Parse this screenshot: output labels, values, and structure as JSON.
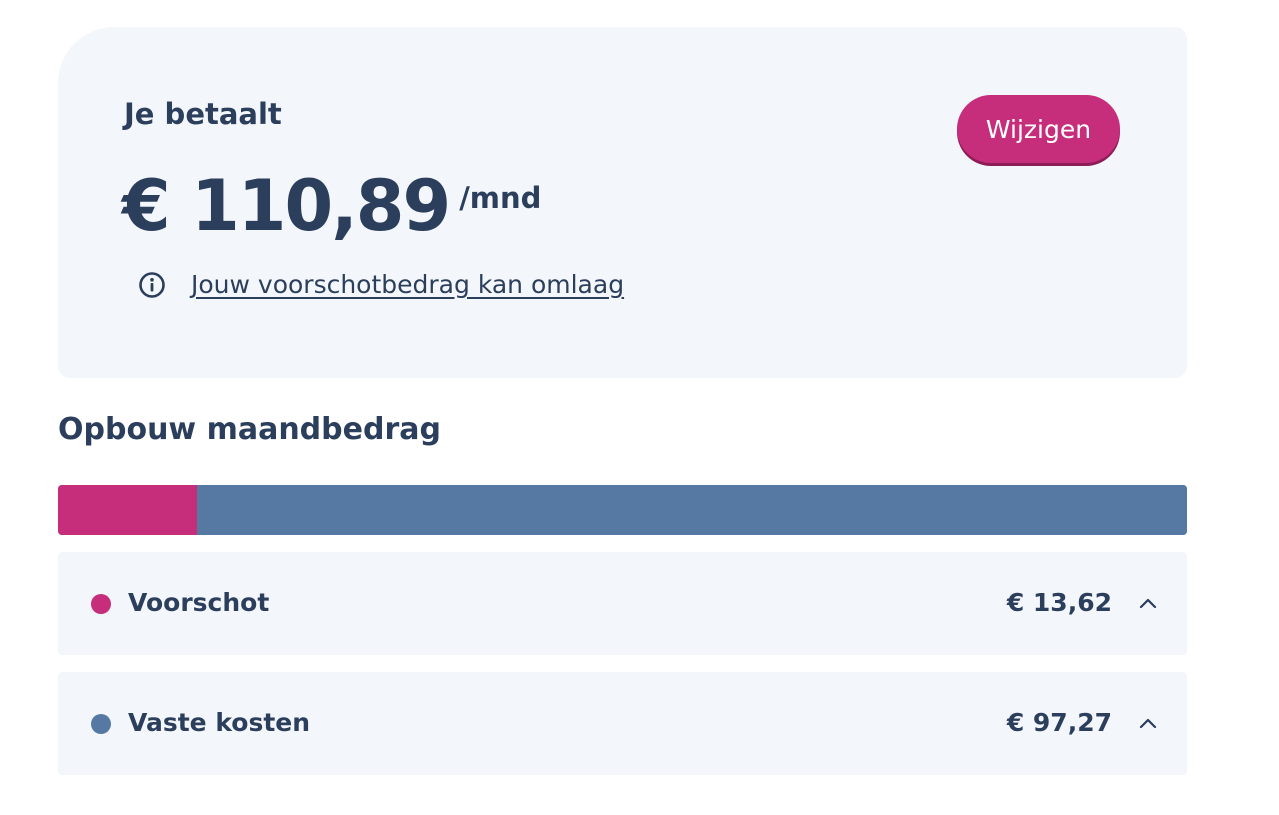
{
  "payment": {
    "label": "Je betaalt",
    "amount": "€ 110,89",
    "period": "/mnd",
    "edit_label": "Wijzigen",
    "info_link": "Jouw voorschotbedrag kan omlaag"
  },
  "breakdown": {
    "title": "Opbouw maandbedrag",
    "bar": [
      {
        "name": "Voorschot",
        "value": 13.62,
        "color": "#c62d7b"
      },
      {
        "name": "Vaste kosten",
        "value": 97.27,
        "color": "#5679a3"
      }
    ],
    "items": [
      {
        "label": "Voorschot",
        "value": "€ 13,62",
        "color": "#c62d7b"
      },
      {
        "label": "Vaste kosten",
        "value": "€ 97,27",
        "color": "#5679a3"
      }
    ]
  },
  "icons": {
    "info": "info-circle-icon",
    "chevron": "chevron-up-icon"
  },
  "colors": {
    "accent": "#c62d7b",
    "secondary": "#5679a3",
    "text": "#2b3e5c",
    "card_bg": "#f3f6fa"
  }
}
